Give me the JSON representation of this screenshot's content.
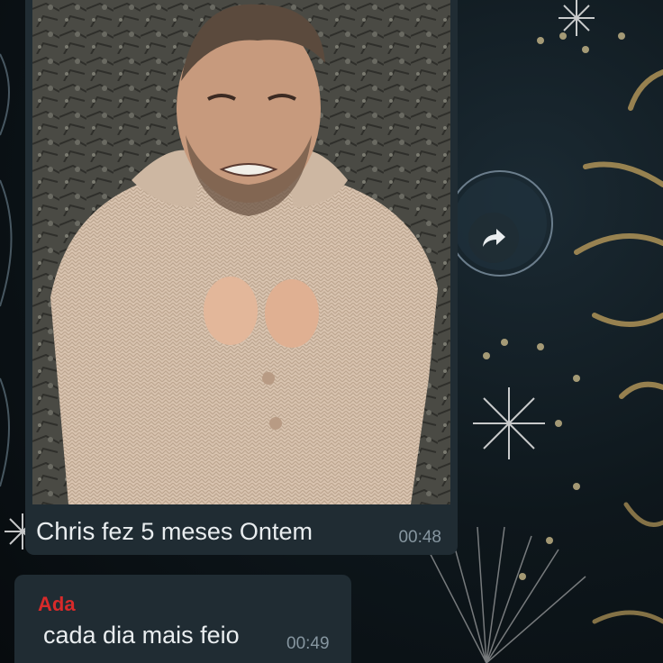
{
  "chat": {
    "messages": [
      {
        "type": "image",
        "caption_name": "Chris",
        "caption_rest": "fez 5 meses Ontem",
        "time": "00:48"
      },
      {
        "type": "text",
        "sender": "Ada",
        "text": "cada dia mais feio",
        "time": "00:49"
      }
    ]
  },
  "icons": {
    "forward": "forward-arrow-icon"
  },
  "colors": {
    "bubble": "#202c33",
    "sender_name": "#d82a2a",
    "text": "#e9edef",
    "timestamp": "#8696a0"
  }
}
